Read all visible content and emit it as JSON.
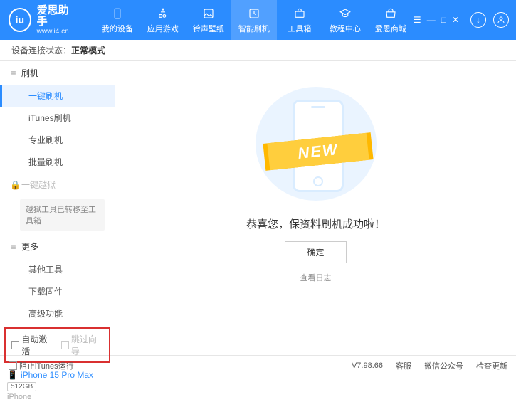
{
  "brand": {
    "title": "爱思助手",
    "subtitle": "www.i4.cn"
  },
  "nav": {
    "items": [
      {
        "label": "我的设备"
      },
      {
        "label": "应用游戏"
      },
      {
        "label": "铃声壁纸"
      },
      {
        "label": "智能刷机"
      },
      {
        "label": "工具箱"
      },
      {
        "label": "教程中心"
      },
      {
        "label": "爱思商城"
      }
    ],
    "activeIndex": 3
  },
  "status": {
    "prefix": "设备连接状态：",
    "value": "正常模式"
  },
  "sidebar": {
    "groupFlash": "刷机",
    "items": {
      "oneKey": "一键刷机",
      "itunes": "iTunes刷机",
      "pro": "专业刷机",
      "batch": "批量刷机"
    },
    "groupJailbreak": "一键越狱",
    "jailbreakNote": "越狱工具已转移至工具箱",
    "groupMore": "更多",
    "more": {
      "other": "其他工具",
      "firmware": "下载固件",
      "advanced": "高级功能"
    },
    "checkbox": {
      "autoActivate": "自动激活",
      "skipGuide": "跳过向导"
    },
    "device": {
      "name": "iPhone 15 Pro Max",
      "storage": "512GB",
      "type": "iPhone"
    }
  },
  "main": {
    "ribbon": "NEW",
    "success": "恭喜您，保资料刷机成功啦！",
    "okBtn": "确定",
    "viewLog": "查看日志"
  },
  "footer": {
    "blockItunes": "阻止iTunes运行",
    "version": "V7.98.66",
    "service": "客服",
    "wechat": "微信公众号",
    "checkUpdate": "检查更新"
  }
}
